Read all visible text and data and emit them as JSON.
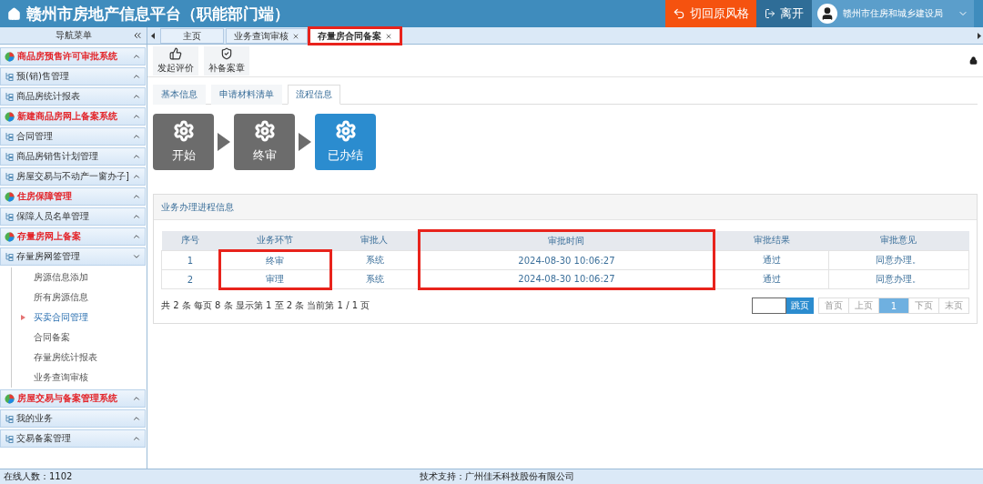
{
  "header": {
    "title": "赣州市房地产信息平台（职能部门端）",
    "switch_button": "切回原风格",
    "leave_button": "离开",
    "user_name": "赣州市住房和城乡建设局"
  },
  "sidebar": {
    "title": "导航菜单",
    "items": [
      {
        "kind": "system",
        "label": "商品房预售许可审批系统",
        "expanded": false
      },
      {
        "kind": "group",
        "label": "预(销)售管理",
        "expanded": false
      },
      {
        "kind": "group",
        "label": "商品房统计报表",
        "expanded": false
      },
      {
        "kind": "system",
        "label": "新建商品房网上备案系统",
        "expanded": false
      },
      {
        "kind": "group",
        "label": "合同管理",
        "expanded": false
      },
      {
        "kind": "group",
        "label": "商品房销售计划管理",
        "expanded": false
      },
      {
        "kind": "group",
        "label": "房屋交易与不动产一窗办子]",
        "expanded": false
      },
      {
        "kind": "system",
        "label": "住房保障管理",
        "expanded": false
      },
      {
        "kind": "group",
        "label": "保障人员名单管理",
        "expanded": false
      },
      {
        "kind": "system",
        "label": "存量房网上备案",
        "expanded": false
      },
      {
        "kind": "group",
        "label": "存量房网签管理",
        "expanded": true,
        "children": [
          {
            "label": "房源信息添加",
            "selected": false
          },
          {
            "label": "所有房源信息",
            "selected": false
          },
          {
            "label": "买卖合同管理",
            "selected": true
          },
          {
            "label": "合同备案",
            "selected": false
          },
          {
            "label": "存量房统计报表",
            "selected": false
          },
          {
            "label": "业务查询审核",
            "selected": false
          }
        ]
      },
      {
        "kind": "system",
        "label": "房屋交易与备案管理系统",
        "expanded": false
      },
      {
        "kind": "group",
        "label": "我的业务",
        "expanded": false
      },
      {
        "kind": "group",
        "label": "交易备案管理",
        "expanded": false
      }
    ]
  },
  "tabs": [
    {
      "label": "主页",
      "selected": false,
      "closable": false,
      "highlighted": false
    },
    {
      "label": "业务查询审核",
      "selected": false,
      "closable": true,
      "highlighted": false
    },
    {
      "label": "存量房合同备案",
      "selected": true,
      "closable": true,
      "highlighted": true
    }
  ],
  "toolbar": [
    {
      "kind": "rate",
      "label": "发起评价"
    },
    {
      "kind": "seal",
      "label": "补备案章"
    }
  ],
  "inner_tabs": [
    {
      "label": "基本信息",
      "selected": false
    },
    {
      "label": "申请材料清单",
      "selected": false
    },
    {
      "label": "流程信息",
      "selected": true
    }
  ],
  "steps": [
    {
      "label": "开始",
      "active": false
    },
    {
      "label": "终审",
      "active": false
    },
    {
      "label": "已办结",
      "active": true
    }
  ],
  "panel": {
    "title": "业务办理进程信息",
    "columns": [
      {
        "label": "序号",
        "framed_header": false,
        "framed_cells": false
      },
      {
        "label": "业务环节",
        "framed_header": false,
        "framed_cells": true
      },
      {
        "label": "审批人",
        "framed_header": false,
        "framed_cells": false
      },
      {
        "label": "审批时间",
        "framed_header": true,
        "framed_cells": true
      },
      {
        "label": "审批结果",
        "framed_header": false,
        "framed_cells": false
      },
      {
        "label": "审批意见",
        "framed_header": false,
        "framed_cells": false
      }
    ],
    "rows": [
      [
        "1",
        "终审",
        "系统",
        "2024-08-30 10:06:27",
        "通过",
        "同意办理。"
      ],
      [
        "2",
        "审理",
        "系统",
        "2024-08-30 10:06:27",
        "通过",
        "同意办理。"
      ]
    ],
    "summary": "共 2 条 每页 8 条 显示第 1 至 2 条 当前第 1 / 1 页",
    "jump_button": "跳页",
    "pager": [
      {
        "label": "首页",
        "selected": false
      },
      {
        "label": "上页",
        "selected": false
      },
      {
        "label": "1",
        "selected": true
      },
      {
        "label": "下页",
        "selected": false
      },
      {
        "label": "末页",
        "selected": false
      }
    ]
  },
  "status_bar": {
    "online": "在线人数：1102",
    "support": "技术支持：广州佳禾科技股份有限公司"
  }
}
